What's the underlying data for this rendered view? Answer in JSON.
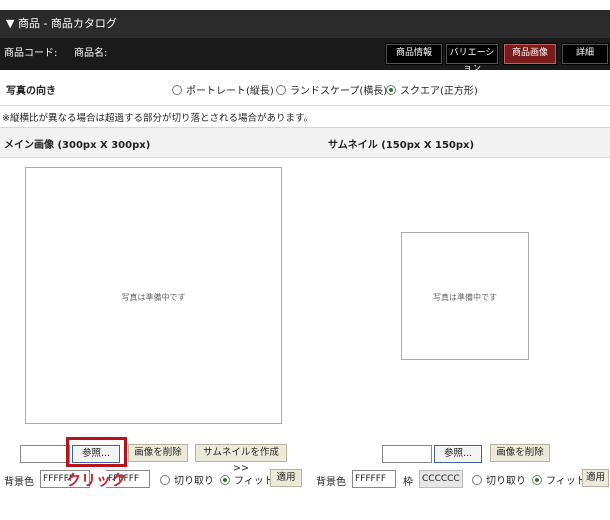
{
  "titlebar": {
    "title": "▼ 商品 - 商品カタログ"
  },
  "infobar": {
    "product_code_label": "商品コード:",
    "product_name_label": "商品名:",
    "tabs": [
      "商品情報",
      "バリエーション",
      "商品画像",
      "詳細"
    ],
    "active_tab": "商品画像"
  },
  "orientation": {
    "heading": "写真の向き",
    "options": [
      "ポートレート(縦長)",
      "ランドスケープ(横長)",
      "スクエア(正方形)"
    ],
    "selected": "スクエア(正方形)"
  },
  "note": "※縦横比が異なる場合は超過する部分が切り落とされる場合があります。",
  "main_image": {
    "heading": "メイン画像 (300px X 300px)",
    "placeholder": "写真は準備中です",
    "browse_label": "参照...",
    "delete_label": "画像を削除",
    "make_thumb_label": "サムネイルを作成>>",
    "bg_label": "背景色",
    "bg_value": "FFFFFF",
    "frame_value": "FFFFFF",
    "crop_label": "切り取り",
    "fit_label": "フィット",
    "apply_label": "適用"
  },
  "thumbnail": {
    "heading": "サムネイル (150px X 150px)",
    "placeholder": "写真は準備中です",
    "browse_label": "参照...",
    "delete_label": "画像を削除",
    "bg_label": "背景色",
    "bg_value": "FFFFFF",
    "frame_label": "枠",
    "frame_value": "CCCCCC",
    "crop_label": "切り取り",
    "fit_label": "フィット",
    "apply_label": "適用"
  },
  "annotation": {
    "text": "クリック"
  },
  "colors": {
    "active_tab": "#7a1b1b",
    "callout": "#b5141e",
    "radio_on": "#2a7a2a"
  }
}
